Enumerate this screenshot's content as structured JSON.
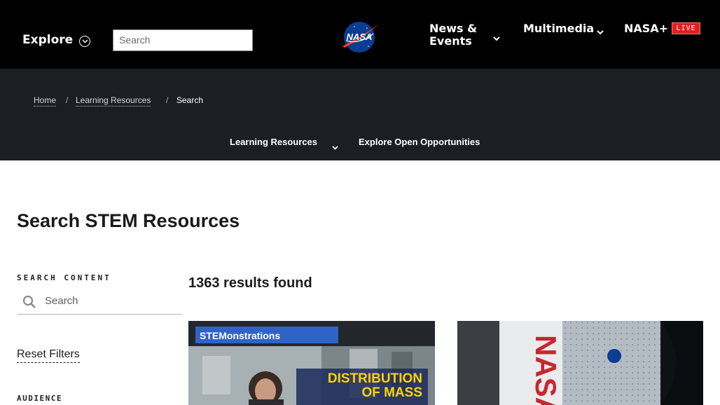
{
  "header": {
    "explore_label": "Explore",
    "search_placeholder": "Search",
    "logo_text": "NASA",
    "nav": {
      "news_events": "News & Events",
      "multimedia": "Multimedia",
      "nasa_plus": "NASA+",
      "live_badge": "LIVE"
    }
  },
  "breadcrumb": {
    "items": [
      "Home",
      "Learning Resources",
      "Search"
    ],
    "separator": "/"
  },
  "subnav": {
    "learning_resources": "Learning Resources",
    "explore_open": "Explore Open Opportunities"
  },
  "main": {
    "title": "Search STEM Resources",
    "results_text": "1363 results found"
  },
  "sidebar": {
    "search_heading": "SEARCH CONTENT",
    "search_placeholder": "Search",
    "reset_label": "Reset Filters",
    "audience_heading": "AUDIENCE"
  },
  "cards": [
    {
      "image_banner": "STEMonstrations",
      "image_headline_line1": "DISTRIBUTION",
      "image_headline_line2": "OF MASS"
    },
    {
      "image_wordmark": "NASA"
    }
  ],
  "colors": {
    "header_bg": "#000000",
    "subnav_bg": "#1b1f23",
    "live_red": "#e02020",
    "nasa_blue": "#0b3d91",
    "nasa_red": "#fc3d21",
    "banner_yellow": "#ffd400"
  }
}
